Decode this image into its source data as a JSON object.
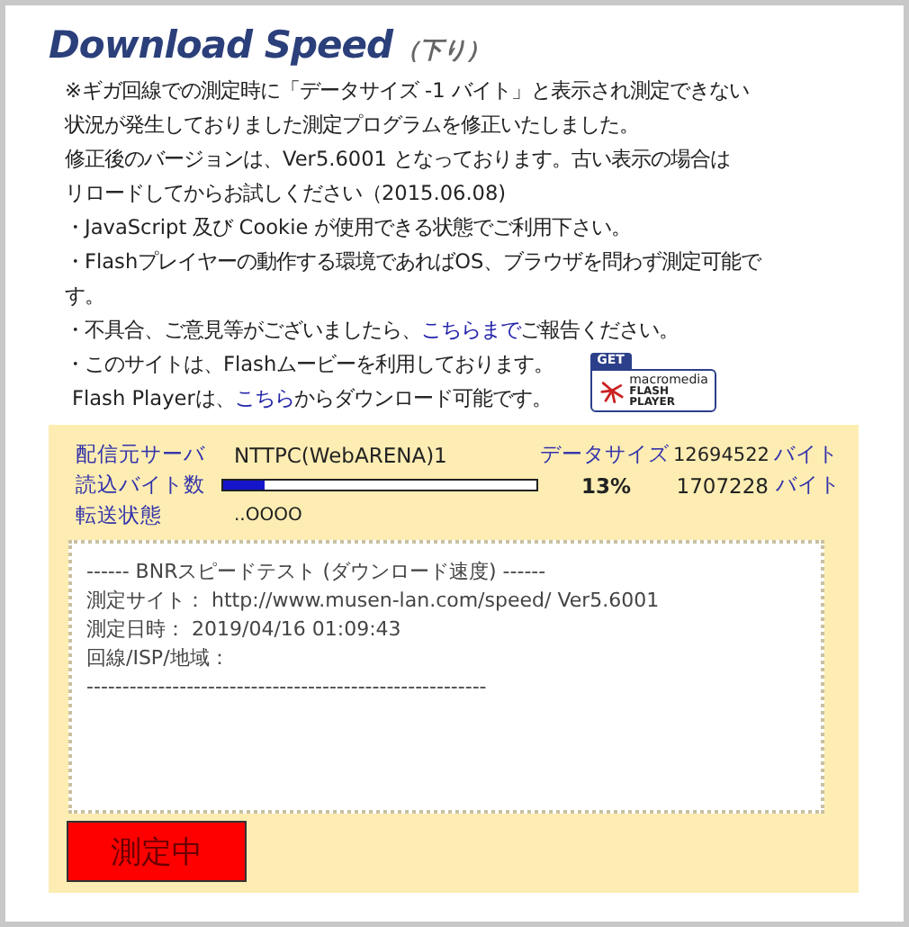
{
  "title": "Download Speed",
  "subtitle": "（下り）",
  "notices": [
    {
      "kind": "text",
      "text": "※ギガ回線での測定時に「データサイズ -1 バイト」と表示され測定できない"
    },
    {
      "kind": "text",
      "text": "状況が発生しておりました測定プログラムを修正いたしました。"
    },
    {
      "kind": "text",
      "text": "修正後のバージョンは、Ver5.6001 となっております。古い表示の場合は"
    },
    {
      "kind": "text",
      "text": "リロードしてからお試しください（2015.06.08)"
    },
    {
      "kind": "text",
      "text": "・JavaScript 及び Cookie が使用できる状態でご利用下さい。"
    },
    {
      "kind": "text",
      "text": "・Flashプレイヤーの動作する環境であればOS、ブラウザを問わず測定可能で"
    },
    {
      "kind": "text",
      "text": "す。"
    },
    {
      "kind": "link",
      "before": "・不具合、ご意見等がございましたら、",
      "link": "こちらまで",
      "after": "ご報告ください。"
    }
  ],
  "flash_notice": {
    "line1": "・このサイトは、Flashムービーを利用しております。",
    "before": "Flash Playerは、",
    "link": "こちら",
    "after": "からダウンロード可能です。"
  },
  "flash_badge": {
    "get": "GET",
    "brand": "macromedia",
    "line1": "FLASH",
    "line2": "PLAYER"
  },
  "panel": {
    "server_label": "配信元サーバ",
    "server": "NTTPC(WebARENA)1",
    "size_label": "データサイズ",
    "size": "12694522",
    "size_unit": "バイト",
    "read_label": "読込バイト数",
    "level": 0.13,
    "percent": "13%",
    "read": "1707228",
    "read_unit": "バイト",
    "status_label": "転送状態",
    "status": "..OOOO",
    "log": [
      "------ BNRスピードテスト (ダウンロード速度) ------",
      "測定サイト： http://www.musen-lan.com/speed/ Ver5.6001",
      "測定日時： 2019/04/16 01:09:43",
      "回線/ISP/地域：",
      "--------------------------------------------------------"
    ],
    "button": "測定中"
  }
}
